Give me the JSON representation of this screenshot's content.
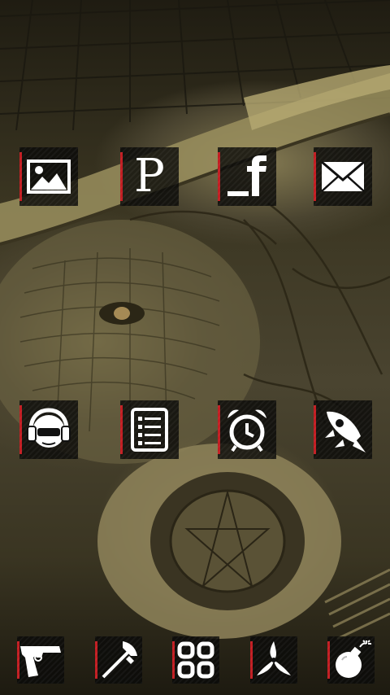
{
  "home": {
    "rows": [
      [
        {
          "name": "gallery-icon",
          "glyph": ""
        },
        {
          "name": "pinterest-icon",
          "glyph": "P"
        },
        {
          "name": "facebook-icon",
          "glyph": ""
        },
        {
          "name": "email-icon",
          "glyph": ""
        }
      ],
      [
        {
          "name": "music-headphones-icon",
          "glyph": ""
        },
        {
          "name": "notes-list-icon",
          "glyph": ""
        },
        {
          "name": "alarm-clock-icon",
          "glyph": ""
        },
        {
          "name": "rocket-icon",
          "glyph": ""
        }
      ]
    ]
  },
  "dock": [
    {
      "name": "pistol-icon"
    },
    {
      "name": "axe-icon"
    },
    {
      "name": "app-drawer-icon"
    },
    {
      "name": "shuriken-icon"
    },
    {
      "name": "bomb-icon"
    }
  ],
  "colors": {
    "accent": "#c21d22",
    "tile": "#0a0a08",
    "glyph": "#ffffff"
  }
}
